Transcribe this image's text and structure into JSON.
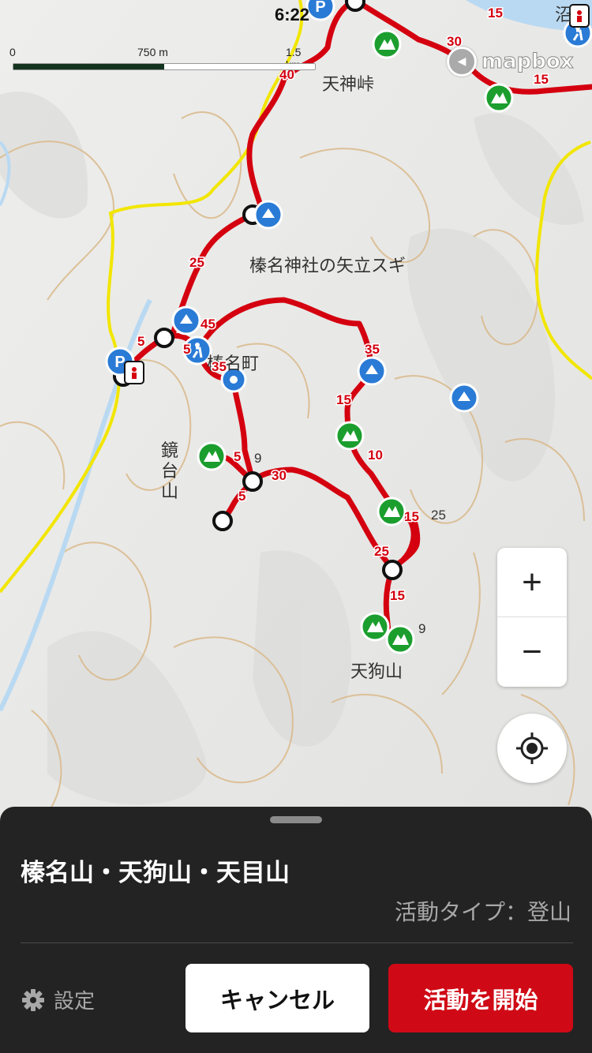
{
  "status_bar": {
    "time": "6:22"
  },
  "scale": {
    "left": "0",
    "mid": "750 m",
    "right": "1.5 km",
    "filled_fraction": 0.5
  },
  "attribution": {
    "logo_text": "mapbox"
  },
  "map": {
    "colors": {
      "route": "#d4000f",
      "road": "#f2e600",
      "river": "#b9d9f2",
      "contour": "#d9b98a",
      "peak": "#1b9e2e",
      "poi": "#2a7bd6",
      "background": "#f4f4f2"
    },
    "place_labels": {
      "tenjin_pass": "天神峠",
      "sugi": "榛名神社の矢立スギ",
      "kagamidai": "鏡台山",
      "tengu": "天狗山",
      "town": "榛名町",
      "top_right": "沼"
    },
    "route_times": {
      "t15a": "15",
      "t30a": "30",
      "t15b": "15",
      "t40": "40",
      "t25a": "25",
      "t45": "45",
      "t5a": "5",
      "t5b": "5",
      "t35a": "35",
      "t35b": "35",
      "t15c": "15",
      "t10": "10",
      "t15d": "15",
      "t25b": "25",
      "t15e": "15",
      "t5c": "5",
      "t5d": "5",
      "t30b": "30"
    },
    "elevation_labels": {
      "e1": "9",
      "e2": "25",
      "e3": "9"
    },
    "icons": [
      "parking-icon",
      "peak-icon",
      "hiker-icon",
      "restroom-icon",
      "shelter-icon",
      "waypoint-icon"
    ]
  },
  "zoom": {
    "in": "+",
    "out": "−"
  },
  "sheet": {
    "title": "榛名山・天狗山・天目山",
    "activity_type": "活動タイプ：登山",
    "settings_label": "設定",
    "cancel_label": "キャンセル",
    "start_label": "活動を開始"
  }
}
